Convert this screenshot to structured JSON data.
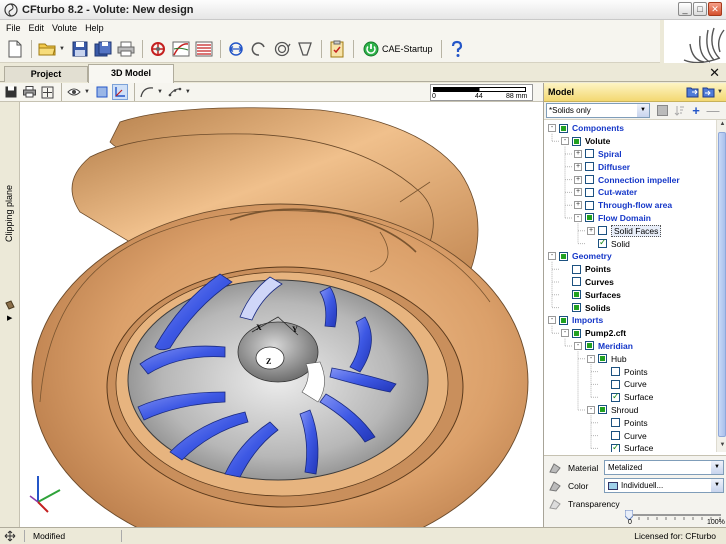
{
  "window": {
    "title": "CFturbo 8.2 - Volute: New design",
    "min": "_",
    "max": "□",
    "close": "✕"
  },
  "menu": [
    "File",
    "Edit",
    "Volute",
    "Help"
  ],
  "toolbar": {
    "cae_label": "CAE-Startup"
  },
  "tabs": [
    "Project",
    "3D Model"
  ],
  "tab_close": "✕",
  "scalebar": {
    "labels": [
      "0",
      "44",
      "88 mm"
    ]
  },
  "clipping_plane": "Clipping plane",
  "model_panel": {
    "title": "Model",
    "filter": "*Solids only"
  },
  "tree": [
    {
      "label": "Components",
      "depth": 0,
      "exp": "-",
      "cb": "filled",
      "style": "blue"
    },
    {
      "label": "Volute",
      "depth": 1,
      "exp": "-",
      "cb": "filled",
      "style": "bold"
    },
    {
      "label": "Spiral",
      "depth": 2,
      "exp": "+",
      "cb": "empty",
      "style": "blue"
    },
    {
      "label": "Diffuser",
      "depth": 2,
      "exp": "+",
      "cb": "empty",
      "style": "blue"
    },
    {
      "label": "Connection impeller",
      "depth": 2,
      "exp": "+",
      "cb": "empty",
      "style": "blue"
    },
    {
      "label": "Cut-water",
      "depth": 2,
      "exp": "+",
      "cb": "empty",
      "style": "blue"
    },
    {
      "label": "Through-flow area",
      "depth": 2,
      "exp": "+",
      "cb": "empty",
      "style": "blue"
    },
    {
      "label": "Flow Domain",
      "depth": 2,
      "exp": "-",
      "cb": "filled",
      "style": "blue"
    },
    {
      "label": "Solid Faces",
      "depth": 3,
      "exp": "+",
      "cb": "empty",
      "style": "boxed"
    },
    {
      "label": "Solid",
      "depth": 3,
      "exp": "",
      "cb": "checked",
      "style": "plain"
    },
    {
      "label": "Geometry",
      "depth": 0,
      "exp": "-",
      "cb": "filled",
      "style": "blue"
    },
    {
      "label": "Points",
      "depth": 1,
      "exp": "",
      "cb": "empty",
      "style": "bold"
    },
    {
      "label": "Curves",
      "depth": 1,
      "exp": "",
      "cb": "empty",
      "style": "bold"
    },
    {
      "label": "Surfaces",
      "depth": 1,
      "exp": "",
      "cb": "filled",
      "style": "bold"
    },
    {
      "label": "Solids",
      "depth": 1,
      "exp": "",
      "cb": "filled",
      "style": "bold"
    },
    {
      "label": "Imports",
      "depth": 0,
      "exp": "-",
      "cb": "filled",
      "style": "blue"
    },
    {
      "label": "Pump2.cft",
      "depth": 1,
      "exp": "-",
      "cb": "filled",
      "style": "bold"
    },
    {
      "label": "Meridian",
      "depth": 2,
      "exp": "-",
      "cb": "filled",
      "style": "blue"
    },
    {
      "label": "Hub",
      "depth": 3,
      "exp": "-",
      "cb": "filled",
      "style": "plain"
    },
    {
      "label": "Points",
      "depth": 4,
      "exp": "",
      "cb": "empty",
      "style": "plain"
    },
    {
      "label": "Curve",
      "depth": 4,
      "exp": "",
      "cb": "empty",
      "style": "plain"
    },
    {
      "label": "Surface",
      "depth": 4,
      "exp": "",
      "cb": "checked",
      "style": "plain"
    },
    {
      "label": "Shroud",
      "depth": 3,
      "exp": "-",
      "cb": "filled",
      "style": "plain"
    },
    {
      "label": "Points",
      "depth": 4,
      "exp": "",
      "cb": "empty",
      "style": "plain"
    },
    {
      "label": "Curve",
      "depth": 4,
      "exp": "",
      "cb": "empty",
      "style": "plain"
    },
    {
      "label": "Surface",
      "depth": 4,
      "exp": "",
      "cb": "checked",
      "style": "plain"
    }
  ],
  "properties": {
    "material_label": "Material",
    "material_value": "Metalized",
    "color_label": "Color",
    "color_value": "Individuell...",
    "transparency_label": "Transparency",
    "transparency_min": "0",
    "transparency_max": "100%",
    "transparency_value": 0
  },
  "viewport": {
    "axis_labels": [
      "X",
      "Y",
      "Z"
    ]
  },
  "status": {
    "modified": "Modified",
    "license": "Licensed for: CFturbo"
  },
  "colors": {
    "volute": "#d9a06a",
    "impeller": "#4a63e6",
    "accent": "#1537c8",
    "model_header": "#f3d872"
  }
}
